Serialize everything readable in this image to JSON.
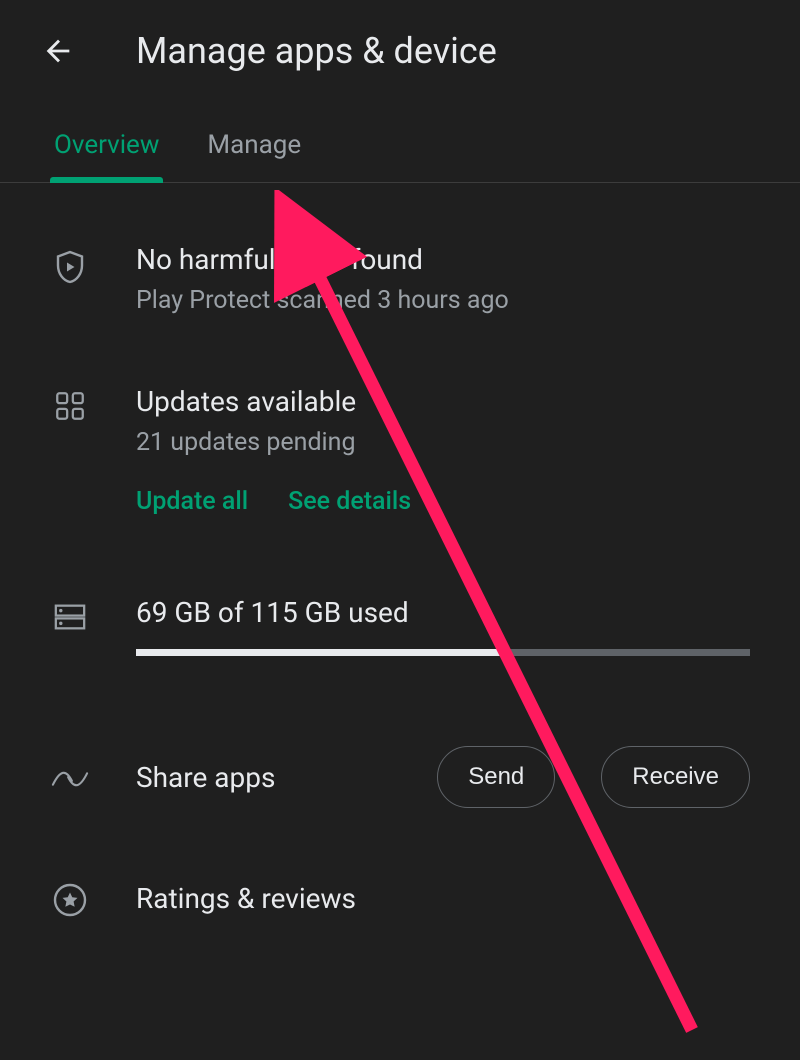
{
  "header": {
    "title": "Manage apps & device"
  },
  "tabs": {
    "overview": "Overview",
    "manage": "Manage"
  },
  "protect": {
    "title": "No harmful apps found",
    "subtitle": "Play Protect scanned 3 hours ago"
  },
  "updates": {
    "title": "Updates available",
    "subtitle": "21 updates pending",
    "update_all": "Update all",
    "see_details": "See details"
  },
  "storage": {
    "text": "69 GB of 115 GB used",
    "used": 69,
    "total": 115,
    "percent": 60
  },
  "share": {
    "label": "Share apps",
    "send": "Send",
    "receive": "Receive"
  },
  "ratings": {
    "label": "Ratings & reviews"
  }
}
